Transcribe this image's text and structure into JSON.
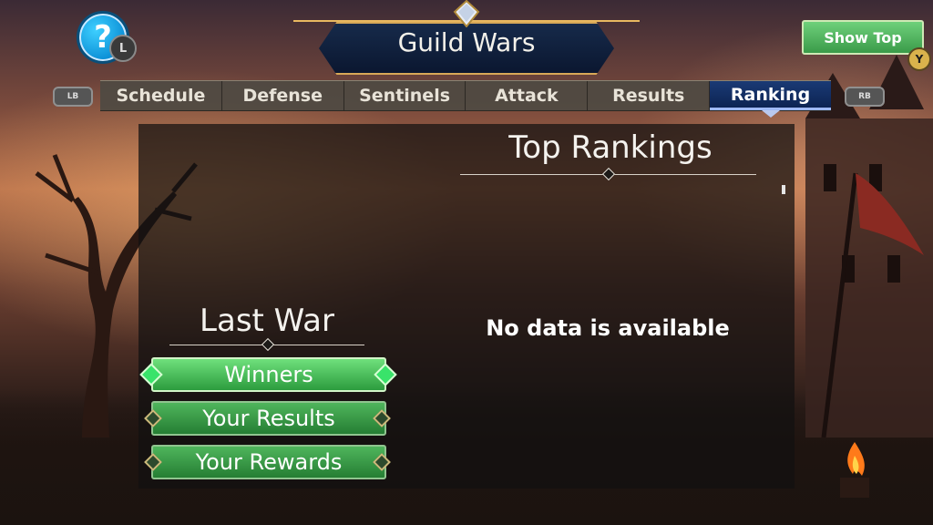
{
  "header": {
    "title": "Guild Wars",
    "help_glyph": "?",
    "help_button_hint": "L",
    "show_top_label": "Show Top",
    "show_top_hint": "Y"
  },
  "tabs": {
    "prev_hint": "LB",
    "next_hint": "RB",
    "items": [
      {
        "label": "Schedule"
      },
      {
        "label": "Defense"
      },
      {
        "label": "Sentinels"
      },
      {
        "label": "Attack"
      },
      {
        "label": "Results"
      },
      {
        "label": "Ranking"
      }
    ],
    "active": "Ranking"
  },
  "top_rankings": {
    "title": "Top Rankings",
    "empty_message": "No data is available"
  },
  "last_war": {
    "title": "Last War",
    "buttons": [
      {
        "label": "Winners",
        "selected": true
      },
      {
        "label": "Your Results",
        "selected": false
      },
      {
        "label": "Your Rewards",
        "selected": false
      }
    ]
  },
  "colors": {
    "active_tab": "#0d2453",
    "button_green": "#3a9b49",
    "title_gold": "#d8a857"
  }
}
